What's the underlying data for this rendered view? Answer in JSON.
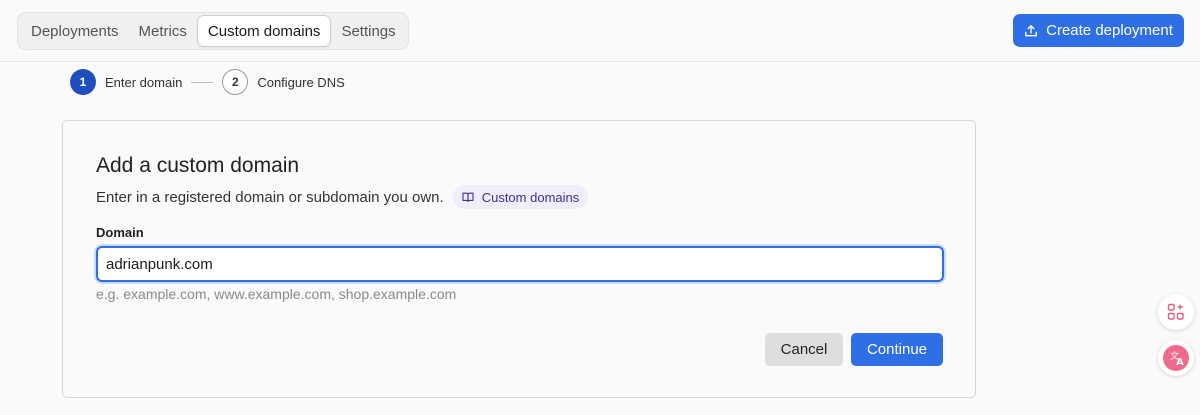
{
  "tabs": {
    "items": [
      {
        "label": "Deployments",
        "active": false
      },
      {
        "label": "Metrics",
        "active": false
      },
      {
        "label": "Custom domains",
        "active": true
      },
      {
        "label": "Settings",
        "active": false
      }
    ]
  },
  "header": {
    "create_button": {
      "label": "Create deployment",
      "icon": "upload-icon"
    }
  },
  "stepper": {
    "steps": [
      {
        "number": "1",
        "label": "Enter domain",
        "state": "current"
      },
      {
        "number": "2",
        "label": "Configure DNS",
        "state": "upcoming"
      }
    ]
  },
  "card": {
    "title": "Add a custom domain",
    "description": "Enter in a registered domain or subdomain you own.",
    "docs_link": {
      "label": "Custom domains",
      "icon": "book-icon"
    },
    "field_label": "Domain",
    "input_value": "adrianpunk.com",
    "hint": "e.g. example.com, www.example.com, shop.example.com",
    "cancel_label": "Cancel",
    "continue_label": "Continue"
  },
  "colors": {
    "accent": "#2f6fe6",
    "step_active": "#1f4fbf",
    "chip_bg": "#f0eefb",
    "chip_text": "#3b3296"
  },
  "floating_buttons": [
    {
      "icon": "apps-sparkle-icon"
    },
    {
      "icon": "translate-icon"
    }
  ]
}
